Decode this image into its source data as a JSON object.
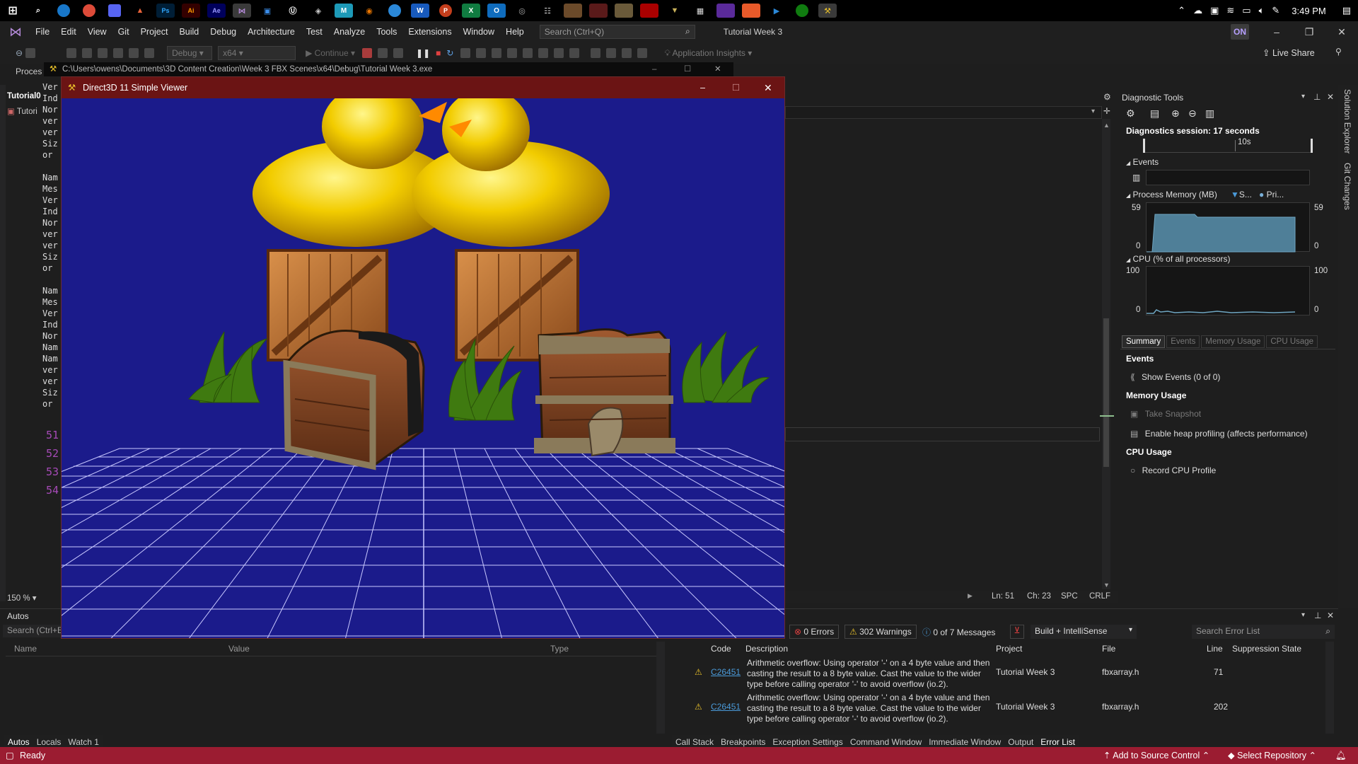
{
  "taskbar": {
    "time": "3:49 PM"
  },
  "menu": {
    "items": [
      "File",
      "Edit",
      "View",
      "Git",
      "Project",
      "Build",
      "Debug",
      "Architecture",
      "Test",
      "Analyze",
      "Tools",
      "Extensions",
      "Window",
      "Help"
    ],
    "search_placeholder": "Search (Ctrl+Q)",
    "solution_title": "Tutorial Week 3",
    "badge": "ON"
  },
  "toolbar": {
    "config": "Debug",
    "platform": "x64",
    "continue_label": "Continue",
    "app_insights": "Application Insights",
    "live_share": "Live Share",
    "process_label": "Proces"
  },
  "editor": {
    "tab_label": "Tutorial0",
    "file_label": "Tutori",
    "code_lines": [
      "Ver",
      "Ind",
      "Nor",
      "ver",
      "ver",
      "Siz",
      "or ",
      "",
      "Nam",
      "Mes",
      "Ver",
      "Ind",
      "Nor",
      "ver",
      "ver",
      "Siz",
      "or ",
      "",
      "Nam",
      "Mes",
      "Ver",
      "Ind",
      "Nor",
      "Nam",
      "Nam",
      "ver",
      "ver",
      "Siz",
      "or "
    ],
    "line_numbers": [
      "51",
      "52",
      "53",
      "54"
    ],
    "zoom": "150 %",
    "ln": "Ln: 51",
    "ch": "Ch: 23",
    "spc": "SPC",
    "crlf": "CRLF"
  },
  "console": {
    "path": "C:\\Users\\owens\\Documents\\3D Content Creation\\Week 3 FBX Scenes\\x64\\Debug\\Tutorial Week 3.exe"
  },
  "viewer": {
    "title": "Direct3D 11 Simple Viewer",
    "colors": {
      "sky": "#1b1b8b",
      "grid": "#c8c8ff",
      "duck": "#f5d000",
      "crate": "#b06a2c",
      "grass": "#3f7a10"
    }
  },
  "diagnostics": {
    "title": "Diagnostic Tools",
    "session": "Diagnostics session: 17 seconds",
    "timeline_label": "10s",
    "events_label": "Events",
    "memory_label": "Process Memory (MB)",
    "memory_legend_s": "S...",
    "memory_legend_p": "Pri...",
    "memory_max": "59",
    "memory_min": "0",
    "cpu_label": "CPU (% of all processors)",
    "cpu_max": "100",
    "cpu_min": "0",
    "tabs": [
      "Summary",
      "Events",
      "Memory Usage",
      "CPU Usage"
    ],
    "section_events": "Events",
    "show_events": "Show Events (0 of 0)",
    "section_memory": "Memory Usage",
    "take_snapshot": "Take Snapshot",
    "heap_profiling": "Enable heap profiling (affects performance)",
    "section_cpu": "CPU Usage",
    "record_cpu": "Record CPU Profile"
  },
  "right_rail": {
    "solution_explorer": "Solution Explorer",
    "git_changes": "Git Changes"
  },
  "autos": {
    "title": "Autos",
    "search_placeholder": "Search (Ctrl+E)",
    "columns": [
      "Name",
      "Value",
      "Type"
    ],
    "tabs": [
      "Autos",
      "Locals",
      "Watch 1"
    ]
  },
  "error_list": {
    "errors": "0 Errors",
    "warnings": "302 Warnings",
    "messages": "0 of 7 Messages",
    "scope": "Build + IntelliSense",
    "search_placeholder": "Search Error List",
    "columns": [
      "Code",
      "Description",
      "Project",
      "File",
      "Line",
      "Suppression State"
    ],
    "rows": [
      {
        "code": "C26451",
        "description": "Arithmetic overflow: Using operator '-' on a 4 byte value and then casting the result to a 8 byte value. Cast the value to the wider type before calling operator '-' to avoid overflow (io.2).",
        "project": "Tutorial Week 3",
        "file": "fbxarray.h",
        "line": "71"
      },
      {
        "code": "C26451",
        "description": "Arithmetic overflow: Using operator '-' on a 4 byte value and then casting the result to a 8 byte value. Cast the value to the wider type before calling operator '-' to avoid overflow (io.2).",
        "project": "Tutorial Week 3",
        "file": "fbxarray.h",
        "line": "202"
      }
    ],
    "tabs": [
      "Call Stack",
      "Breakpoints",
      "Exception Settings",
      "Command Window",
      "Immediate Window",
      "Output",
      "Error List"
    ]
  },
  "statusbar": {
    "ready": "Ready",
    "add_source": "Add to Source Control",
    "select_repo": "Select Repository"
  }
}
